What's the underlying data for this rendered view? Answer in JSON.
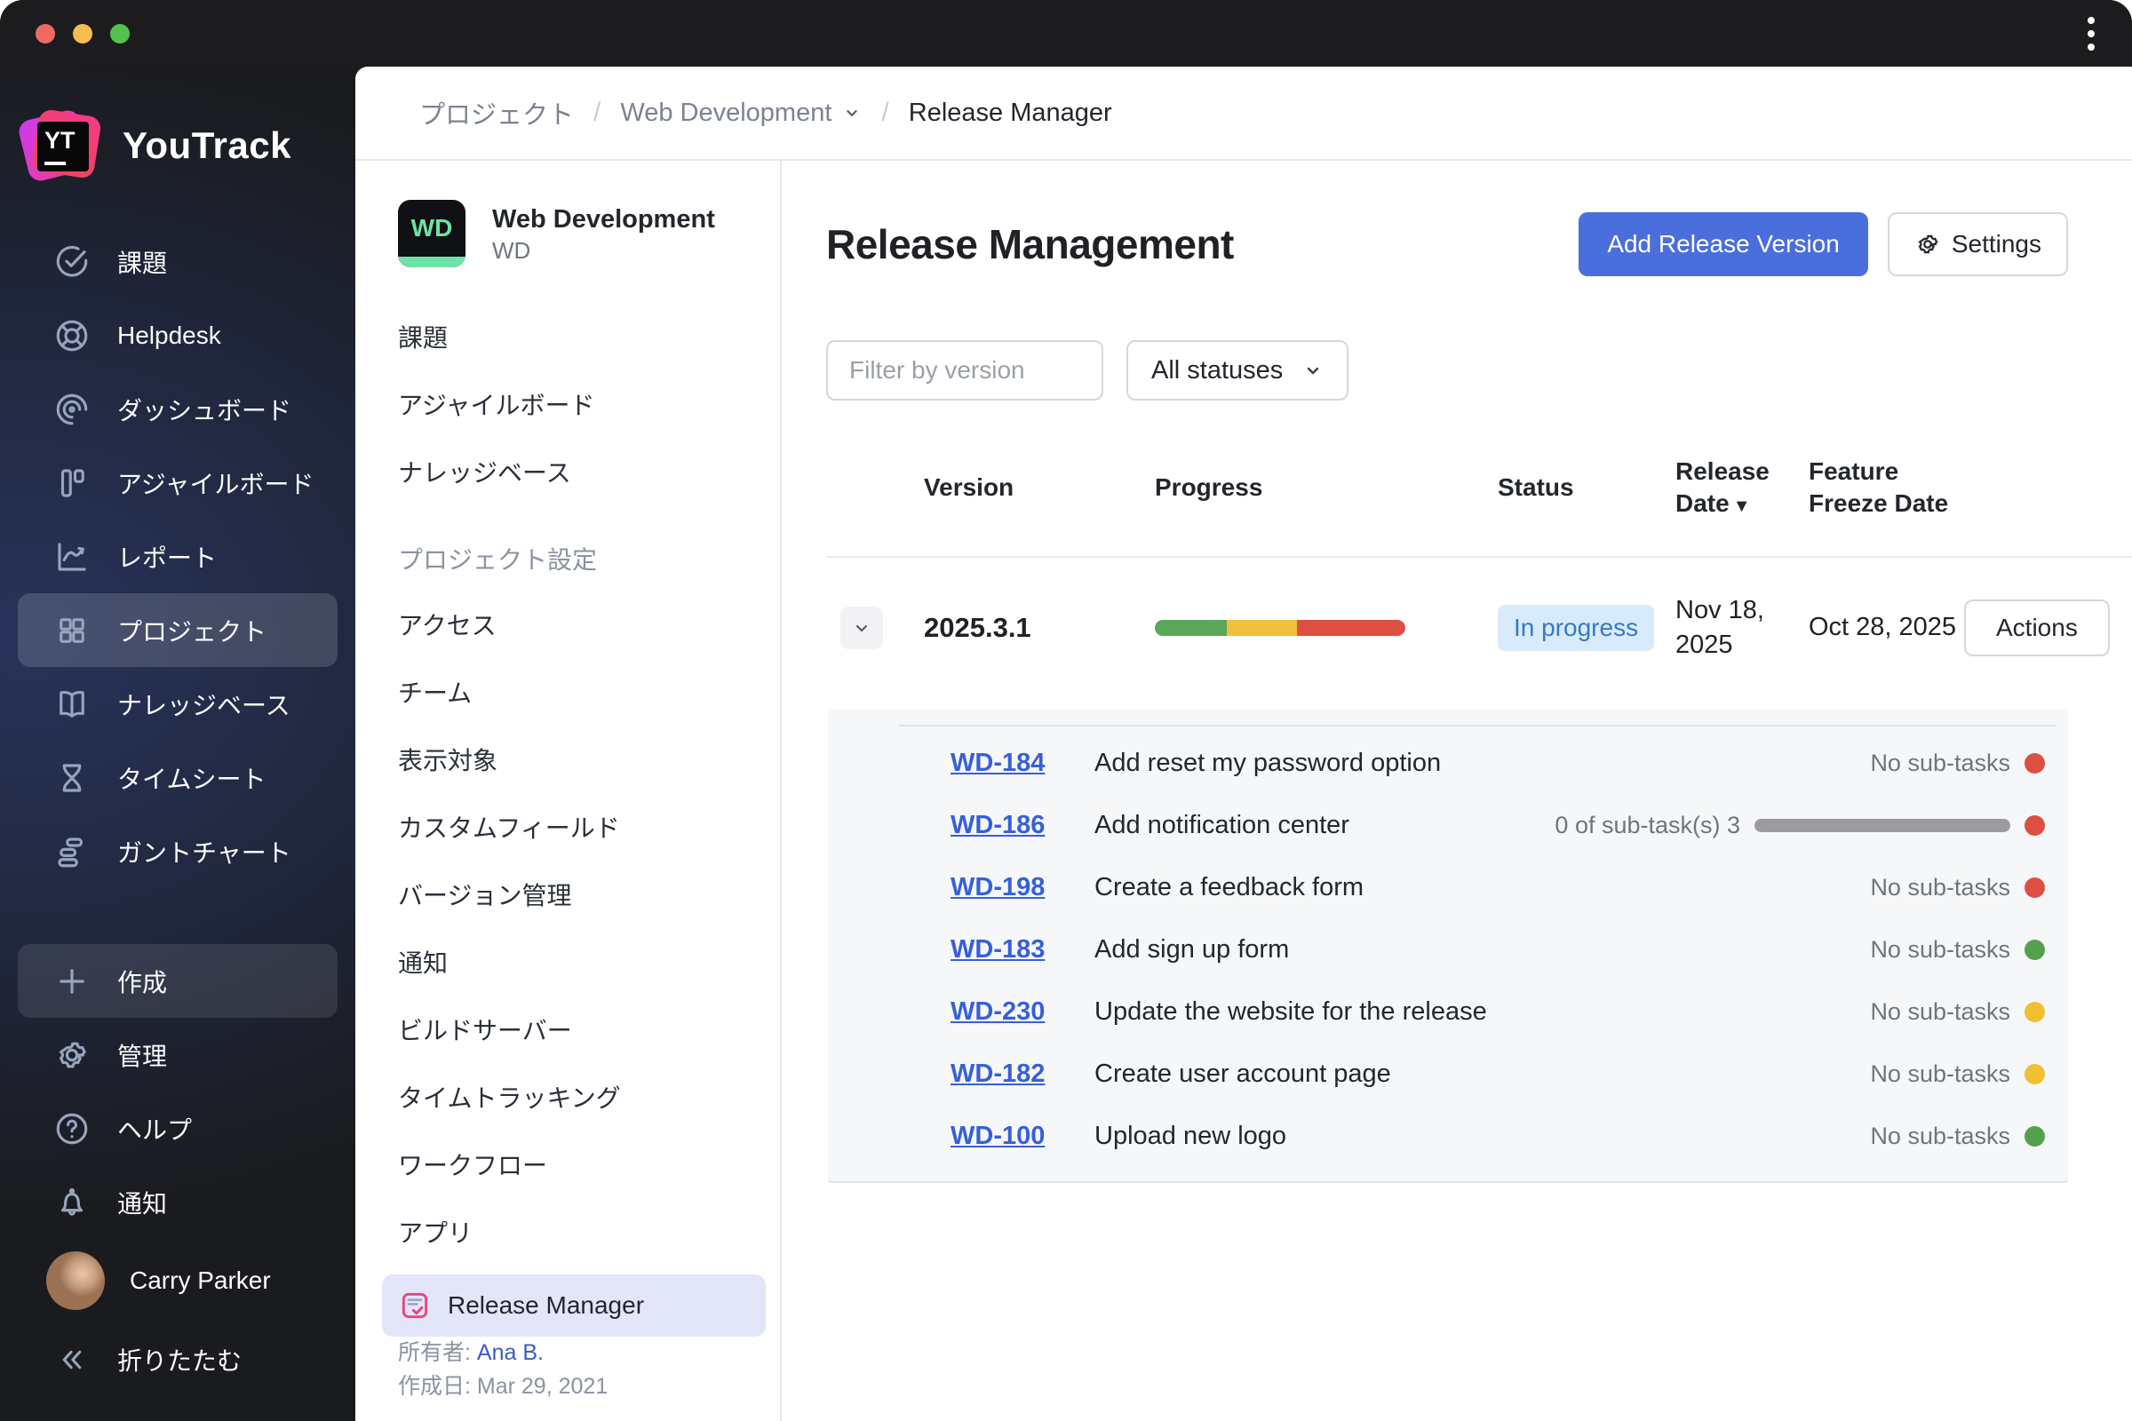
{
  "logo": {
    "badge": "YT",
    "text": "YouTrack"
  },
  "sidebar": {
    "items": [
      {
        "label": "課題",
        "icon": "issues-check-icon"
      },
      {
        "label": "Helpdesk",
        "icon": "lifebuoy-icon"
      },
      {
        "label": "ダッシュボード",
        "icon": "dashboard-icon"
      },
      {
        "label": "アジャイルボード",
        "icon": "agile-board-icon"
      },
      {
        "label": "レポート",
        "icon": "report-chart-icon"
      },
      {
        "label": "プロジェクト",
        "icon": "projects-grid-icon",
        "selected": true
      },
      {
        "label": "ナレッジベース",
        "icon": "knowledge-book-icon"
      },
      {
        "label": "タイムシート",
        "icon": "timesheet-hourglass-icon"
      },
      {
        "label": "ガントチャート",
        "icon": "gantt-icon"
      }
    ],
    "create_label": "作成",
    "admin_label": "管理",
    "help_label": "ヘルプ",
    "notifications_label": "通知",
    "user_name": "Carry Parker",
    "collapse_label": "折りたたむ"
  },
  "breadcrumb": {
    "items": [
      "プロジェクト",
      "Web Development",
      "Release Manager"
    ],
    "separator": "/"
  },
  "project_panel": {
    "avatar_text": "WD",
    "name": "Web Development",
    "short_name": "WD",
    "menu": [
      "課題",
      "アジャイルボード",
      "ナレッジベース"
    ],
    "settings_header": "プロジェクト設定",
    "settings_menu": [
      "アクセス",
      "チーム",
      "表示対象",
      "カスタムフィールド",
      "バージョン管理",
      "通知",
      "ビルドサーバー",
      "タイムトラッキング",
      "ワークフロー",
      "アプリ"
    ],
    "app_item": "Release Manager",
    "owner_label": "所有者:",
    "owner_name": "Ana B.",
    "created_label": "作成日:",
    "created_date": "Mar 29, 2021"
  },
  "main": {
    "title": "Release Management",
    "add_button": "Add Release Version",
    "settings_button": "Settings",
    "filter_placeholder": "Filter by version",
    "status_filter": "All statuses",
    "columns": [
      "Version",
      "Progress",
      "Status",
      "Release Date",
      "Feature Freeze Date"
    ],
    "sort_indicator": "▼",
    "release": {
      "version": "2025.3.1",
      "status": "In progress",
      "release_date": "Nov 18, 2025",
      "feature_freeze_date": "Oct 28, 2025",
      "actions_label": "Actions",
      "progress": {
        "green_pct": 29,
        "yellow_pct": 28,
        "red_pct": 43,
        "green_style": "width:28.7%",
        "yellow_style": "width:28.2%",
        "red_style": "width:43.1%"
      }
    },
    "tasks": [
      {
        "id": "WD-184",
        "title": "Add reset my password option",
        "subtask_text": "No sub-tasks",
        "dot": "red"
      },
      {
        "id": "WD-186",
        "title": "Add notification center",
        "subtask_text": "0 of sub-task(s) 3",
        "dot": "red",
        "has_bar": true
      },
      {
        "id": "WD-198",
        "title": "Create a feedback form",
        "subtask_text": "No sub-tasks",
        "dot": "red"
      },
      {
        "id": "WD-183",
        "title": "Add sign up form",
        "subtask_text": "No sub-tasks",
        "dot": "green"
      },
      {
        "id": "WD-230",
        "title": "Update the website for the release",
        "subtask_text": "No sub-tasks",
        "dot": "yellow"
      },
      {
        "id": "WD-182",
        "title": "Create user account page",
        "subtask_text": "No sub-tasks",
        "dot": "yellow"
      },
      {
        "id": "WD-100",
        "title": "Upload new logo",
        "subtask_text": "No sub-tasks",
        "dot": "green"
      }
    ],
    "colors": {
      "accent_blue": "#4a6edb",
      "link_blue": "#3660d9",
      "badge_bg": "#d7ebfa",
      "badge_text": "#3a78c2",
      "progress_green": "#5aa758",
      "progress_yellow": "#f0c23c",
      "progress_red": "#dd5041",
      "dot_green": "#55a04c",
      "dot_yellow": "#f0c030",
      "panel_bg": "#f6f7f8"
    }
  }
}
